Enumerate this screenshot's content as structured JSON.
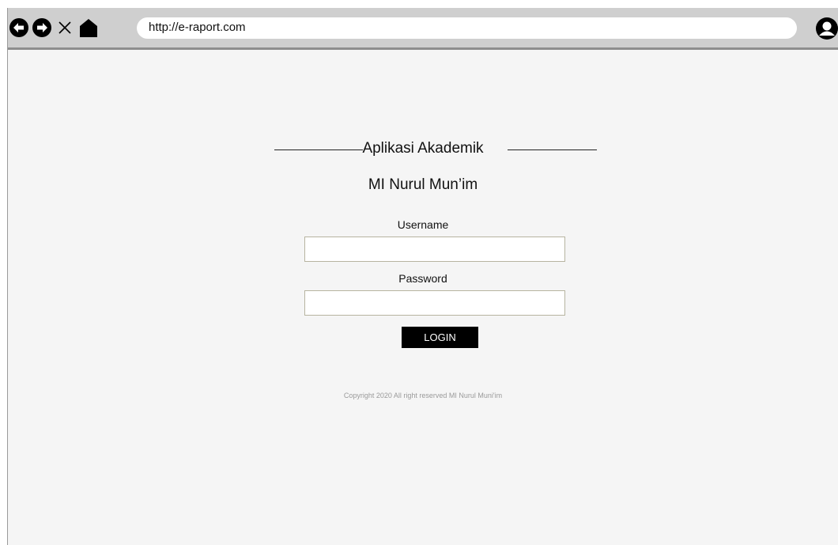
{
  "browser": {
    "url": "http://e-raport.com",
    "back_icon": "arrow-left-circle-icon",
    "forward_icon": "arrow-right-circle-icon",
    "close_icon": "x-icon",
    "home_icon": "home-icon",
    "profile_icon": "user-icon"
  },
  "login": {
    "title": "Aplikasi Akademik",
    "subtitle": "MI Nurul Mun’im",
    "username_label": "Username",
    "username_value": "",
    "password_label": "Password",
    "password_value": "",
    "login_button": "LOGIN",
    "copyright": "Copyright 2020 All right reserved MI Nurul Muni'im"
  },
  "colors": {
    "toolbar_bg": "#cfcfcf",
    "page_bg": "#f5f5f5",
    "button_bg": "#000000",
    "button_text": "#ffffff",
    "field_border": "#b7b4a0",
    "copyright_text": "#9a9a9a"
  }
}
